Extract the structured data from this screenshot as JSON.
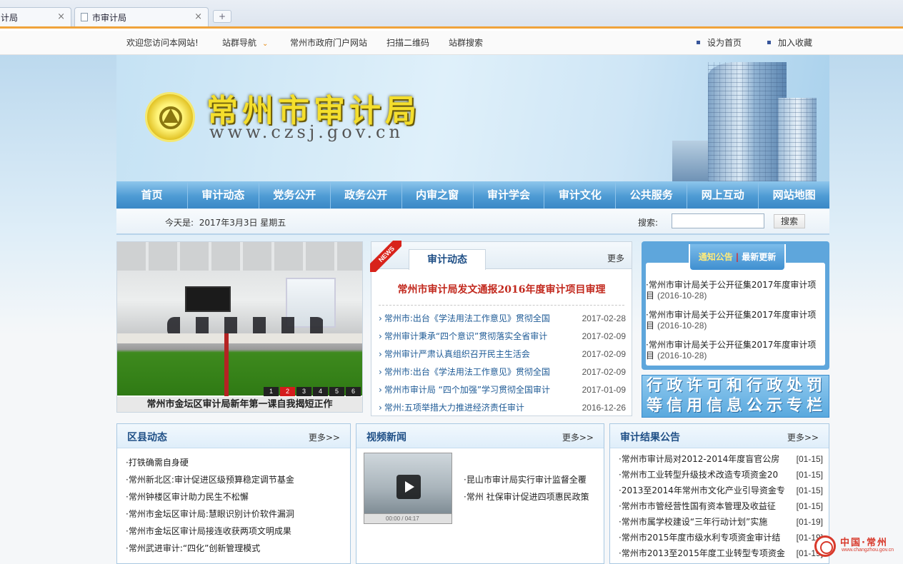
{
  "browser": {
    "tabs": [
      {
        "label": "计局",
        "close": "×"
      },
      {
        "label": "市审计局",
        "close": "×"
      }
    ],
    "new_tab": "+"
  },
  "topbar": {
    "welcome": "欢迎您访问本网站!",
    "site_nav": "站群导航",
    "gov_portal": "常州市政府门户网站",
    "qr": "扫描二维码",
    "site_search": "站群搜索",
    "set_home": "设为首页",
    "add_fav": "加入收藏"
  },
  "banner": {
    "title": "常州市审计局",
    "url": "www.czsj.gov.cn"
  },
  "nav": [
    "首页",
    "审计动态",
    "党务公开",
    "政务公开",
    "内审之窗",
    "审计学会",
    "审计文化",
    "公共服务",
    "网上互动",
    "网站地图"
  ],
  "datebar": {
    "date_label": "今天是:",
    "date_value": "2017年3月3日 星期五",
    "search_label": "搜索:",
    "search_value": "",
    "search_button": "搜索"
  },
  "slideshow": {
    "caption": "常州市金坛区审计局新年第一课自我揭短正作",
    "pages": [
      "1",
      "2",
      "3",
      "4",
      "5",
      "6"
    ],
    "active_page": "2"
  },
  "news": {
    "ribbon": "NEWS",
    "tab": "审计动态",
    "more": "更多",
    "headline": "常州市审计局发文通报2016年度审计项目审理",
    "items": [
      {
        "title": "常州市:出台《学法用法工作意见》贯彻全国",
        "date": "2017-02-28"
      },
      {
        "title": "常州审计秉承“四个意识”贯彻落实全省审计",
        "date": "2017-02-09"
      },
      {
        "title": "常州审计严肃认真组织召开民主生活会",
        "date": "2017-02-09"
      },
      {
        "title": "常州市:出台《学法用法工作意见》贯彻全国",
        "date": "2017-02-09"
      },
      {
        "title": "常州市审计局 “四个加强”学习贯彻全国审计",
        "date": "2017-01-09"
      },
      {
        "title": "常州:五项举措大力推进经济责任审计",
        "date": "2016-12-26"
      }
    ]
  },
  "notice": {
    "tab_active": "通知公告",
    "tab_other": "最新更新",
    "items": [
      {
        "title": "·常州市审计局关于公开征集2017年度审计项目",
        "date": "(2016-10-28)"
      },
      {
        "title": "·常州市审计局关于公开征集2017年度审计项目",
        "date": "(2016-10-28)"
      },
      {
        "title": "·常州市审计局关于公开征集2017年度审计项目",
        "date": "(2016-10-28)"
      }
    ]
  },
  "promo": {
    "line1": "行政许可和行政处罚",
    "line2": "等信用信息公示专栏"
  },
  "county": {
    "title": "区县动态",
    "more": "更多>>",
    "items": [
      "·打铁确需自身硬",
      "·常州新北区:审计促进区级预算稳定调节基金",
      "·常州钟楼区审计助力民生不松懈",
      "·常州市金坛区审计局:慧眼识别计价软件漏洞",
      "·常州市金坛区审计局接连收获两项文明成果",
      "·常州武进审计:“四化”创新管理模式"
    ]
  },
  "video": {
    "title": "视频新闻",
    "more": "更多>>",
    "player_time": "00:00 / 04:17",
    "items": [
      "·昆山市审计局实行审计监督全覆",
      "·常州 社保审计促进四项惠民政策"
    ]
  },
  "results": {
    "title": "审计结果公告",
    "more": "更多>>",
    "items": [
      {
        "title": "·常州市审计局对2012-2014年度盲官公房",
        "date": "[01-15]"
      },
      {
        "title": "·常州市工业转型升级技术改造专项资金20",
        "date": "[01-15]"
      },
      {
        "title": "·2013至2014年常州市文化产业引导资金专",
        "date": "[01-15]"
      },
      {
        "title": "·常州市市管经营性国有资本管理及收益征",
        "date": "[01-15]"
      },
      {
        "title": "·常州市属学校建设“三年行动计划”实施",
        "date": "[01-19]"
      },
      {
        "title": "·常州市2015年度市级水利专项资金审计结",
        "date": "[01-19]"
      },
      {
        "title": "·常州市2013至2015年度工业转型专项资金",
        "date": "[01-19]"
      }
    ]
  },
  "corner_logo": {
    "name": "中国·常州",
    "site": "www.changzhou.gov.cn"
  },
  "colors": {
    "nav_blue": "#4e9bd4",
    "headline_red": "#c2291e",
    "link_blue": "#1f5b96",
    "title_blue": "#1f4f86",
    "tab_orange": "#f0a33b"
  }
}
